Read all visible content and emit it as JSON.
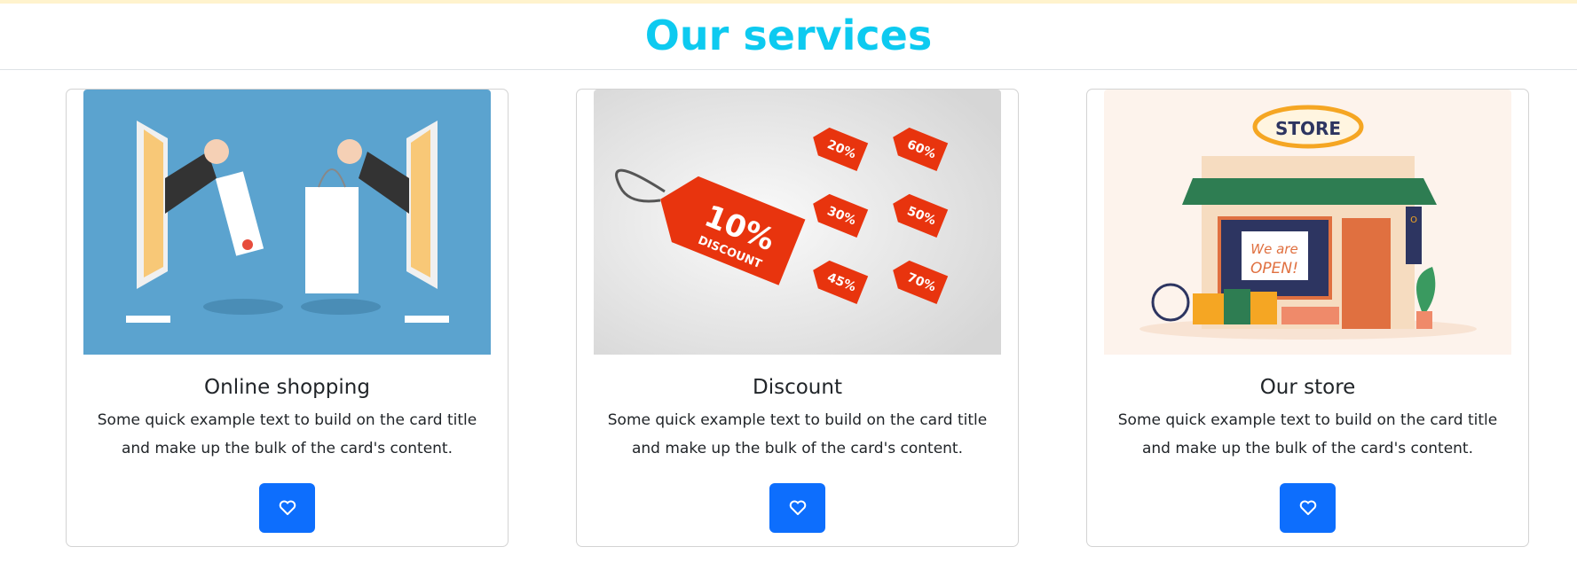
{
  "header": {
    "title": "Our services"
  },
  "cards": [
    {
      "title": "Online shopping",
      "text": "Some quick example text to build on the card title and make up the bulk of the card's content.",
      "button_icon": "heart-icon",
      "image": "online-shopping-illustration"
    },
    {
      "title": "Discount",
      "text": "Some quick example text to build on the card title and make up the bulk of the card's content.",
      "button_icon": "heart-icon",
      "image": "discount-tags-illustration",
      "tags": [
        "10%",
        "20%",
        "60%",
        "30%",
        "50%",
        "45%",
        "70%"
      ],
      "tag_sub": "DISCOUNT"
    },
    {
      "title": "Our store",
      "text": "Some quick example text to build on the card title and make up the bulk of the card's content.",
      "button_icon": "heart-icon",
      "image": "store-illustration",
      "sign": "STORE",
      "window_sign": "We are OPEN!",
      "side_sign": "OPEN"
    }
  ],
  "colors": {
    "title": "#0dcaf0",
    "button": "#0d6efd"
  }
}
